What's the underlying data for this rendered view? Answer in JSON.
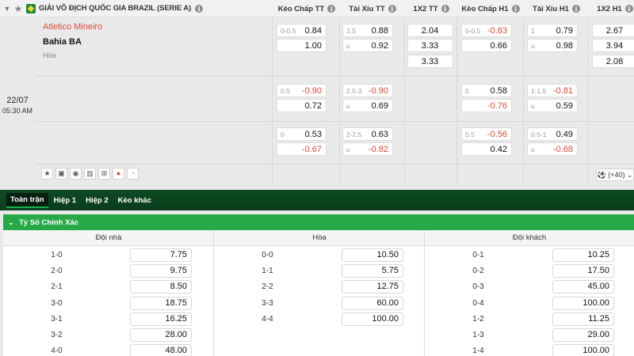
{
  "header": {
    "league": "GIẢI VÔ ĐỊCH QUỐC GIA BRAZIL (SERIE A)",
    "columns": [
      "Kèo Chấp TT",
      "Tài Xỉu TT",
      "1X2 TT",
      "Kèo Chấp H1",
      "Tài Xỉu H1",
      "1X2 H1"
    ]
  },
  "match": {
    "home": "Atletico Mineiro",
    "away": "Bahia BA",
    "draw_label": "Hòa",
    "date": "22/07",
    "time": "05:30 AM",
    "more_markets": "(+40)"
  },
  "odds_rows": [
    {
      "hdp_tt": [
        {
          "line": "0-0.5",
          "odd": "0.84"
        },
        {
          "line": "",
          "odd": "1.00"
        }
      ],
      "ou_tt": [
        {
          "line": "2.5",
          "odd": "0.88"
        },
        {
          "line": "u",
          "odd": "0.92"
        }
      ],
      "x12_tt": [
        "2.04",
        "3.33",
        "3.33"
      ],
      "hdp_h1": [
        {
          "line": "0-0.5",
          "odd": "-0.83"
        },
        {
          "line": "",
          "odd": "0.66"
        }
      ],
      "ou_h1": [
        {
          "line": "1",
          "odd": "0.79"
        },
        {
          "line": "u",
          "odd": "0.98"
        }
      ],
      "x12_h1": [
        "2.67",
        "3.94",
        "2.08"
      ]
    },
    {
      "hdp_tt": [
        {
          "line": "0.5",
          "odd": "-0.90"
        },
        {
          "line": "",
          "odd": "0.72"
        }
      ],
      "ou_tt": [
        {
          "line": "2.5-3",
          "odd": "-0.90"
        },
        {
          "line": "u",
          "odd": "0.69"
        }
      ],
      "hdp_h1": [
        {
          "line": "0",
          "odd": "0.58"
        },
        {
          "line": "",
          "odd": "-0.76"
        }
      ],
      "ou_h1": [
        {
          "line": "1-1.5",
          "odd": "-0.81"
        },
        {
          "line": "u",
          "odd": "0.59"
        }
      ]
    },
    {
      "hdp_tt": [
        {
          "line": "0",
          "odd": "0.53"
        },
        {
          "line": "",
          "odd": "-0.67"
        }
      ],
      "ou_tt": [
        {
          "line": "2-2.5",
          "odd": "0.63"
        },
        {
          "line": "u",
          "odd": "-0.82"
        }
      ],
      "hdp_h1": [
        {
          "line": "0.5",
          "odd": "-0.56"
        },
        {
          "line": "",
          "odd": "0.42"
        }
      ],
      "ou_h1": [
        {
          "line": "0.5-1",
          "odd": "0.49"
        },
        {
          "line": "u",
          "odd": "-0.68"
        }
      ]
    }
  ],
  "tabs": [
    "Toàn trận",
    "Hiệp 1",
    "Hiệp 2",
    "Kèo khác"
  ],
  "correct_score": {
    "title": "Tỷ Số Chính Xác",
    "headers": [
      "Đội nhà",
      "Hòa",
      "Đội khách"
    ],
    "home": [
      [
        "1-0",
        "7.75"
      ],
      [
        "2-0",
        "9.75"
      ],
      [
        "2-1",
        "8.50"
      ],
      [
        "3-0",
        "18.75"
      ],
      [
        "3-1",
        "16.25"
      ],
      [
        "3-2",
        "28.00"
      ],
      [
        "4-0",
        "48.00"
      ]
    ],
    "draw": [
      [
        "0-0",
        "10.50"
      ],
      [
        "1-1",
        "5.75"
      ],
      [
        "2-2",
        "12.75"
      ],
      [
        "3-3",
        "60.00"
      ],
      [
        "4-4",
        "100.00"
      ]
    ],
    "away": [
      [
        "0-1",
        "10.25"
      ],
      [
        "0-2",
        "17.50"
      ],
      [
        "0-3",
        "45.00"
      ],
      [
        "0-4",
        "100.00"
      ],
      [
        "1-2",
        "11.25"
      ],
      [
        "1-3",
        "29.00"
      ],
      [
        "1-4",
        "100.00"
      ]
    ]
  },
  "colors": {
    "negative": "#e0493a",
    "brand_green": "#26a946",
    "dark_green": "#0c4a22"
  }
}
